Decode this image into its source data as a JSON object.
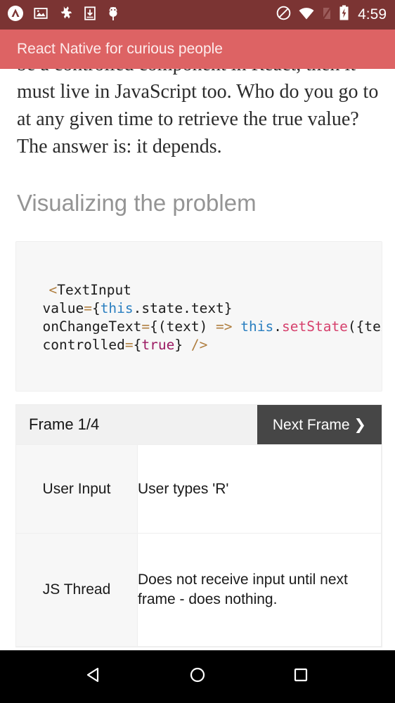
{
  "status_bar": {
    "background": "#7b3433",
    "left_icons": [
      {
        "name": "app-logo-icon",
        "label": "expo-logo"
      },
      {
        "name": "image-icon",
        "label": "screenshot"
      },
      {
        "name": "puzzle-icon",
        "label": "plugin"
      },
      {
        "name": "download-to-device-icon",
        "label": "download"
      },
      {
        "name": "android-bug-icon",
        "label": "debug"
      }
    ],
    "right_icons": [
      {
        "name": "do-not-disturb-icon",
        "label": "do-not-disturb"
      },
      {
        "name": "wifi-icon",
        "label": "wifi"
      },
      {
        "name": "signal-off-icon",
        "label": "no-signal"
      },
      {
        "name": "battery-charging-icon",
        "label": "battery-charging"
      }
    ],
    "clock": "4:59"
  },
  "app_bar": {
    "title": "React Native for curious people",
    "background": "#dd6364",
    "title_color": "#fdecec"
  },
  "article": {
    "paragraph": "be a controlled component in React, then it must live in JavaScript too. Who do you go to at any given time to retrieve the true value? The answer is: it depends.",
    "heading": "Visualizing the problem",
    "heading_color": "#949494"
  },
  "code_block": {
    "background": "#f7f7f7",
    "colors": {
      "punct": "#b07f40",
      "this": "#2a7fc0",
      "function": "#d6416d",
      "boolean": "#9c1a63",
      "plain": "#1c1c1c"
    },
    "lines": [
      [
        {
          "t": "<",
          "c": "punct"
        },
        {
          "t": "TextInput",
          "c": "plain"
        }
      ],
      [
        {
          "t": "  value",
          "c": "plain"
        },
        {
          "t": "=",
          "c": "punct"
        },
        {
          "t": "{",
          "c": "plain"
        },
        {
          "t": "this",
          "c": "this"
        },
        {
          "t": ".state.text}",
          "c": "plain"
        }
      ],
      [
        {
          "t": "  onChangeText",
          "c": "plain"
        },
        {
          "t": "=",
          "c": "punct"
        },
        {
          "t": "{(text) ",
          "c": "plain"
        },
        {
          "t": "=>",
          "c": "punct"
        },
        {
          "t": " ",
          "c": "plain"
        },
        {
          "t": "this",
          "c": "this"
        },
        {
          "t": ".",
          "c": "plain"
        },
        {
          "t": "setState",
          "c": "fn"
        },
        {
          "t": "({text}) }",
          "c": "plain"
        }
      ],
      [
        {
          "t": "  controlled",
          "c": "plain"
        },
        {
          "t": "=",
          "c": "punct"
        },
        {
          "t": "{",
          "c": "plain"
        },
        {
          "t": "true",
          "c": "bool"
        },
        {
          "t": "} ",
          "c": "plain"
        },
        {
          "t": "/>",
          "c": "punct"
        }
      ]
    ]
  },
  "frame_widget": {
    "frame_label": "Frame 1/4",
    "next_button": "Next Frame ❯",
    "next_button_bg": "#464646",
    "header_bg": "#f1f1f1",
    "rows": [
      {
        "label": "User Input",
        "value": "User types 'R'"
      },
      {
        "label": "JS Thread",
        "value": "Does not receive input until next frame - does nothing."
      }
    ]
  },
  "nav_bar": {
    "background": "#000000",
    "buttons": [
      {
        "name": "nav-back-button",
        "icon": "back-triangle-icon"
      },
      {
        "name": "nav-home-button",
        "icon": "home-circle-icon"
      },
      {
        "name": "nav-recents-button",
        "icon": "recents-square-icon"
      }
    ]
  }
}
